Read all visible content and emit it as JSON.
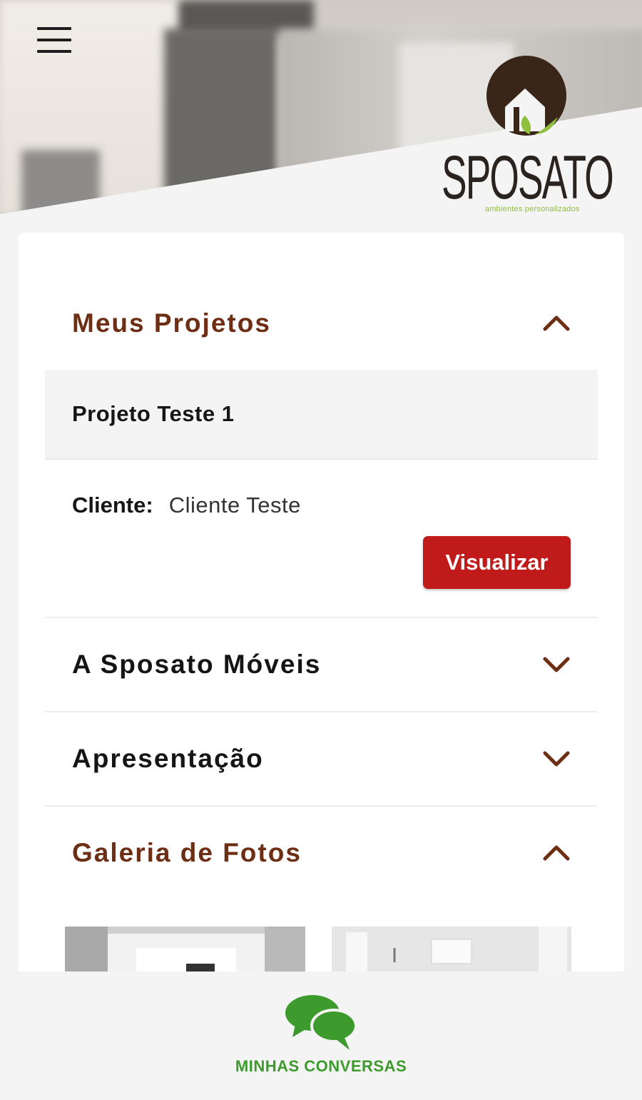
{
  "header": {
    "menu_icon": "hamburger-menu-icon",
    "logo_icon": "sposato-house-logo-icon",
    "brand_name": "SPOSATO",
    "brand_tagline": "ambientes personalizados"
  },
  "sections": [
    {
      "title": "Meus Projetos",
      "expanded": true,
      "color": "#6e2e14"
    },
    {
      "title": "A Sposato Móveis",
      "expanded": false,
      "color": "#151515"
    },
    {
      "title": "Apresentação",
      "expanded": false,
      "color": "#151515"
    },
    {
      "title": "Galeria de Fotos",
      "expanded": true,
      "color": "#6e2e14"
    }
  ],
  "project": {
    "name": "Projeto Teste 1",
    "client_label": "Cliente:",
    "client_value": "Cliente Teste",
    "view_button": "Visualizar"
  },
  "bottom": {
    "chat_icon": "chat-bubbles-icon",
    "chat_label": "MINHAS CONVERSAS"
  },
  "colors": {
    "accent_brown": "#6e2e14",
    "button_red": "#c11a1a",
    "chat_green": "#3d9a2c",
    "logo_green": "#8fbf3c",
    "logo_dark": "#3a2519"
  }
}
